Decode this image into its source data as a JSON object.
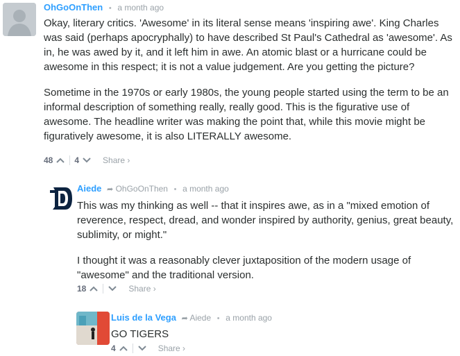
{
  "comments": [
    {
      "author": "OhGoOnThen",
      "time": "a month ago",
      "paragraphs": [
        "Okay, literary critics. 'Awesome' in its literal sense means 'inspiring awe'. King Charles was said (perhaps apocryphally) to have described St Paul's Cathedral as 'awesome'. As in, he was awed by it, and it left him in awe. An atomic blast or a hurricane could be awesome in this respect; it is not a value judgement. Are you getting the picture?",
        "Sometime in the 1970s or early 1980s, the young people started using the term to be an informal description of something really, really good. This is the figurative use of awesome. The headline writer was making the point that, while this movie might be figuratively awesome, it is also LITERALLY awesome."
      ],
      "upvotes": "48",
      "downvotes": "4",
      "share_label": "Share ›"
    },
    {
      "author": "Aiede",
      "reply_to": "OhGoOnThen",
      "time": "a month ago",
      "paragraphs": [
        "This was my thinking as well -- that it inspires awe, as in a \"mixed emotion of reverence, respect, dread, and wonder inspired by authority, genius, great beauty, sublimity, or might.\"",
        "I thought it was a reasonably clever juxtaposition of the modern usage of \"awesome\" and the traditional version."
      ],
      "upvotes": "18",
      "share_label": "Share ›"
    },
    {
      "author": "Luis de la Vega",
      "reply_to": "Aiede",
      "time": "a month ago",
      "paragraphs": [
        "GO TIGERS"
      ],
      "upvotes": "4",
      "share_label": "Share ›"
    }
  ],
  "icons": {
    "upvote": "chevron-up-icon",
    "downvote": "chevron-down-icon",
    "reply_arrow": "reply-arrow-icon"
  },
  "colors": {
    "author_link": "#2e9fff",
    "meta": "#9aa2a8",
    "text": "#2a2e2e"
  }
}
